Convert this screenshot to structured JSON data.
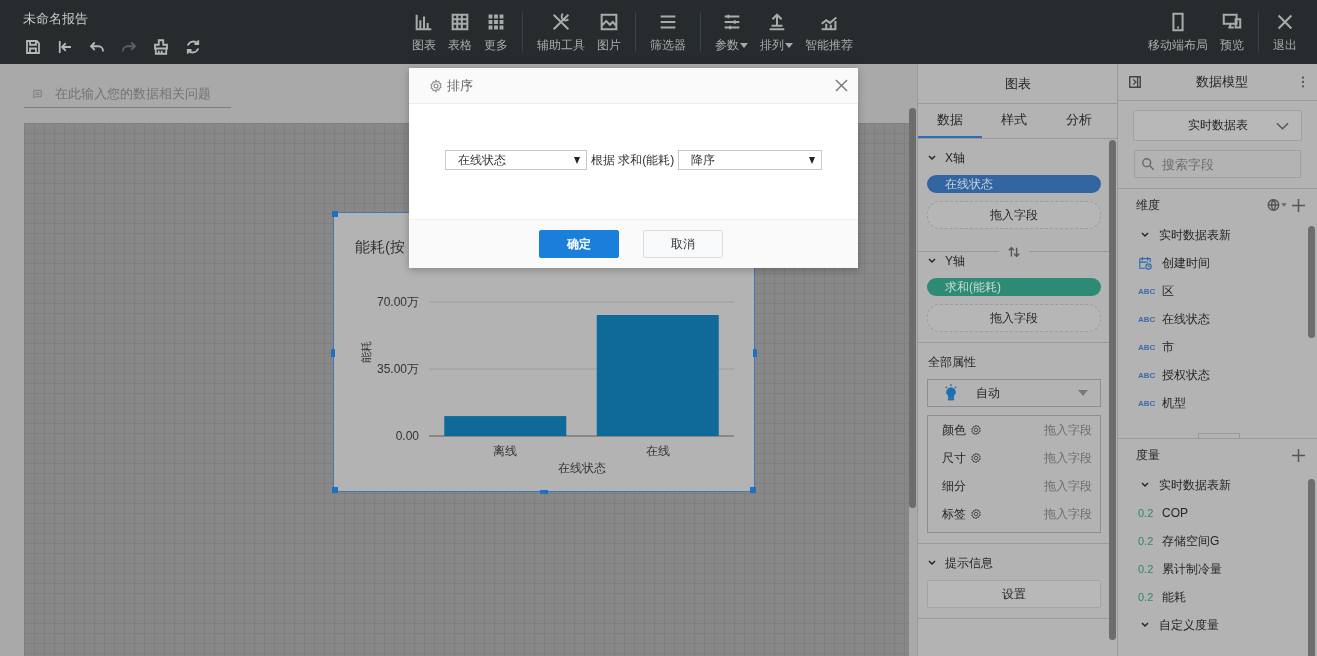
{
  "header": {
    "title": "未命名报告",
    "quick_actions": [
      {
        "disabled": false
      },
      {
        "disabled": false
      },
      {
        "disabled": false
      },
      {
        "disabled": true
      },
      {
        "disabled": false
      },
      {
        "disabled": false
      }
    ],
    "tool_groups": [
      [
        {
          "label": "图表",
          "dropdown": false
        },
        {
          "label": "表格",
          "dropdown": false
        },
        {
          "label": "更多",
          "dropdown": false
        }
      ],
      [
        {
          "label": "辅助工具",
          "dropdown": false
        },
        {
          "label": "图片",
          "dropdown": false
        }
      ],
      [
        {
          "label": "筛选器",
          "dropdown": false
        }
      ],
      [
        {
          "label": "参数",
          "dropdown": true
        },
        {
          "label": "排列",
          "dropdown": true
        },
        {
          "label": "智能推荐",
          "dropdown": false
        }
      ]
    ],
    "right_tools": [
      [
        {
          "label": "移动端布局",
          "dropdown": false
        },
        {
          "label": "预览",
          "dropdown": false
        }
      ],
      [
        {
          "label": "退出",
          "dropdown": false
        }
      ]
    ]
  },
  "question": {
    "placeholder": "在此输入您的数据相关问题"
  },
  "chart_card": {
    "chart_data": {
      "type": "bar",
      "title": "能耗(按",
      "xlabel": "在线状态",
      "ylabel": "能耗",
      "categories": [
        "离线",
        "在线"
      ],
      "values": [
        10.4,
        63.2
      ],
      "ylim": [
        0,
        70
      ],
      "yticks": [
        {
          "value": 0,
          "label": "0.00"
        },
        {
          "value": 35,
          "label": "35.00万"
        },
        {
          "value": 70,
          "label": "70.00万"
        }
      ]
    }
  },
  "dialog": {
    "title": "排序",
    "field_select": "在线状态",
    "by_label": "根据 求和(能耗)",
    "order_select": "降序",
    "buttons": [
      {
        "label": "确定",
        "primary": true
      },
      {
        "label": "取消",
        "primary": false
      }
    ]
  },
  "chart_panel": {
    "title": "图表",
    "tabs": [
      {
        "label": "数据",
        "selected": true
      },
      {
        "label": "样式",
        "selected": false
      },
      {
        "label": "分析",
        "selected": false
      }
    ],
    "axes": [
      {
        "title": "X轴",
        "expanded": true,
        "field": "在线状态",
        "kind": "dimension",
        "drop": "拖入字段"
      },
      {
        "title": "Y轴",
        "expanded": true,
        "field": "求和(能耗)",
        "kind": "measure",
        "drop": "拖入字段"
      }
    ],
    "properties": {
      "title": "全部属性",
      "mark_type": "自动",
      "rows": [
        {
          "label": "颜色",
          "settings": true,
          "drop": "拖入字段"
        },
        {
          "label": "尺寸",
          "settings": true,
          "drop": "拖入字段"
        },
        {
          "label": "细分",
          "settings": false,
          "drop": "拖入字段"
        },
        {
          "label": "标签",
          "settings": true,
          "drop": "拖入字段"
        }
      ]
    },
    "tooltip": {
      "title": "提示信息",
      "expanded": true,
      "button": "设置"
    }
  },
  "model_panel": {
    "title": "数据模型",
    "table_select": "实时数据表",
    "search": {
      "placeholder": "搜索字段"
    },
    "dimensions": {
      "title": "维度",
      "groups": [
        {
          "label": "实时数据表新",
          "expanded": true,
          "children": [
            {
              "kind": "date",
              "name": "创建时间"
            },
            {
              "kind": "text",
              "badge": "ABC",
              "name": "区"
            },
            {
              "kind": "text",
              "badge": "ABC",
              "name": "在线状态"
            },
            {
              "kind": "text",
              "badge": "ABC",
              "name": "市"
            },
            {
              "kind": "text",
              "badge": "ABC",
              "name": "授权状态"
            },
            {
              "kind": "text",
              "badge": "ABC",
              "name": "机型"
            }
          ]
        }
      ]
    },
    "measures": {
      "title": "度量",
      "groups": [
        {
          "label": "实时数据表新",
          "expanded": true,
          "children": [
            {
              "kind": "number",
              "badge": "0.2",
              "name": "COP"
            },
            {
              "kind": "number",
              "badge": "0.2",
              "name": "存储空间G"
            },
            {
              "kind": "number",
              "badge": "0.2",
              "name": "累计制冷量"
            },
            {
              "kind": "number",
              "badge": "0.2",
              "name": "能耗"
            }
          ]
        },
        {
          "label": "自定义度量",
          "expanded": true
        }
      ]
    }
  }
}
